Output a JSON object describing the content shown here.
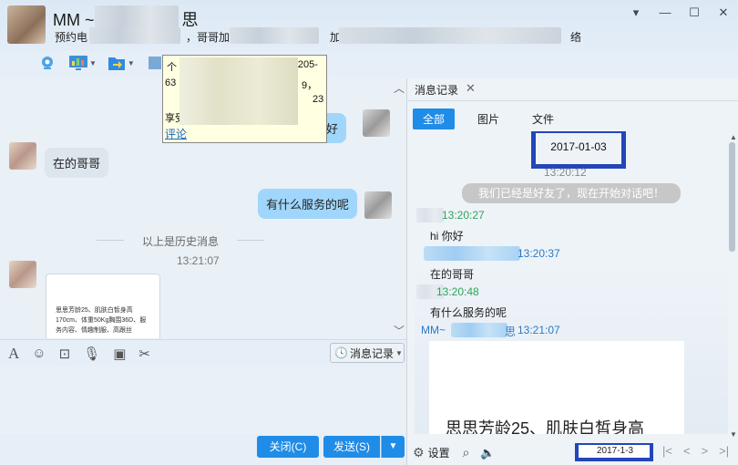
{
  "window": {
    "title_start": "MM ~",
    "title_end": "思",
    "subtitle_segments": [
      "预约电",
      "，哥哥加微",
      "加",
      "络"
    ],
    "controls": [
      "▾",
      "—",
      "☐",
      "✕"
    ]
  },
  "toolbar": {
    "icons": [
      "video-call-icon",
      "screen-share-icon",
      "file-transfer-icon",
      "app-icon",
      "more-icon",
      "folder-icon"
    ]
  },
  "popup": {
    "line1_start": "个",
    "line1_end": "0-8205-",
    "line2_start": "63",
    "line2_end": "9，",
    "line3_end": "23",
    "line4_start": "享受",
    "link": "评论"
  },
  "chat": {
    "messages": [
      {
        "side": "out",
        "text": "你好"
      },
      {
        "side": "in",
        "text": "在的哥哥"
      },
      {
        "side": "out",
        "text": "有什么服务的呢"
      }
    ],
    "history_divider": "以上是历史消息",
    "timestamp": "13:21:07",
    "card_text": "思思芳龄25、肌肤白皙身高170cm、体重50Kg胸围36D、服务内容、情趣制服、高跟丝"
  },
  "input_tools": {
    "history_button": "消息记录"
  },
  "buttons": {
    "close": "关闭(C)",
    "send": "发送(S)"
  },
  "panel": {
    "tab_title": "消息记录",
    "filters": [
      "全部",
      "图片",
      "文件"
    ],
    "active_filter": "全部",
    "date": "2017-01-03",
    "log": [
      {
        "kind": "time",
        "text": "13:20:12"
      },
      {
        "kind": "system",
        "text": "我们已经是好友了，现在开始对话吧！"
      },
      {
        "kind": "sender-time",
        "text": "13:20:27",
        "color": "#2fa35a"
      },
      {
        "kind": "text",
        "text": "hi  你好"
      },
      {
        "kind": "sender-time",
        "text": "13:20:37",
        "color": "#2a7ac4"
      },
      {
        "kind": "text",
        "text": "在的哥哥"
      },
      {
        "kind": "sender-time",
        "text": "13:20:48",
        "color": "#2fa35a"
      },
      {
        "kind": "text",
        "text": "有什么服务的呢"
      },
      {
        "kind": "sender-time",
        "sender_start": "MM~",
        "sender_end": "思",
        "text": "13:21:07",
        "color": "#2a7ac4"
      }
    ],
    "card_text": "思思芳龄25、肌肤白皙身高",
    "settings_label": "设置",
    "date_field": "2017-1-3",
    "pager": [
      "|<",
      "<",
      ">",
      ">|"
    ]
  },
  "colors": {
    "accent": "#1f8ce8",
    "highlight_box": "#2346b8",
    "incoming_time": "#2fa35a",
    "outgoing_time": "#2a7ac4"
  }
}
